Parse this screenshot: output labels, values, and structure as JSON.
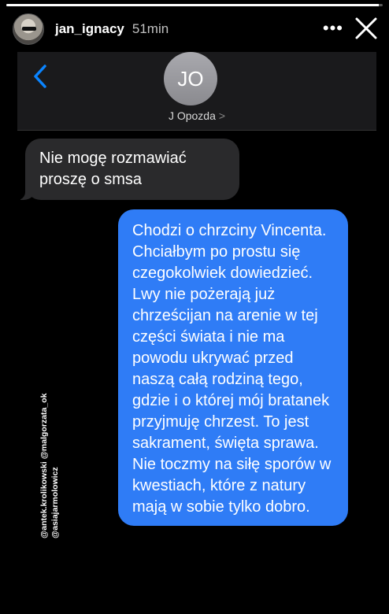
{
  "story": {
    "username": "jan_ignacy",
    "time_ago": "51min",
    "more_label": "•••",
    "progress": 0.99
  },
  "imessage": {
    "contact_initials": "JO",
    "contact_name": "J Opozda",
    "contact_chevron": ">",
    "messages": [
      {
        "direction": "incoming",
        "text": "Nie mogę rozmawiać proszę o smsa"
      },
      {
        "direction": "outgoing",
        "text": "Chodzi o chrzciny Vincenta. Chciałbym po prostu się czegokolwiek dowiedzieć. Lwy nie pożerają już chrześcijan na arenie w tej części świata i nie ma powodu ukrywać przed naszą całą rodziną tego, gdzie i o której mój bratanek przyjmuję chrzest. To jest sakrament, święta sprawa. Nie toczmy na siłę sporów w kwestiach, które z natury mają w sobie tylko dobro."
      }
    ]
  },
  "mentions": {
    "line1": "@antek.krolikowski @malgorzata_ok",
    "line2": "@asiajarmolowicz"
  },
  "colors": {
    "outgoing_bubble": "#2f7cf6",
    "incoming_bubble": "#2a2a2c",
    "ios_blue": "#0a84ff"
  }
}
